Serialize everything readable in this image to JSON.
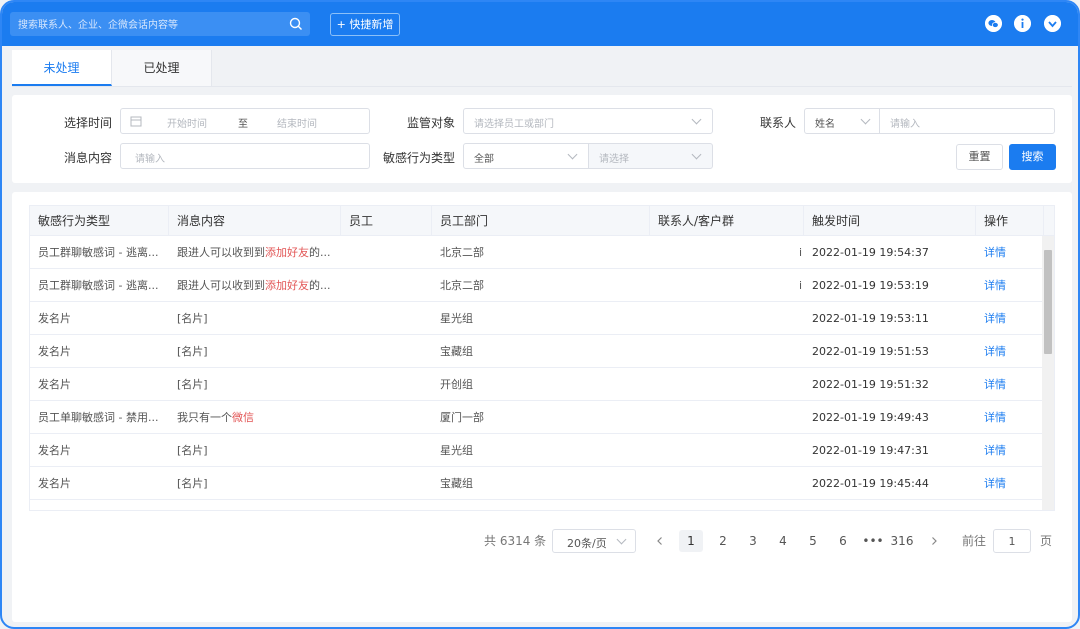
{
  "topbar": {
    "search_placeholder": "搜索联系人、企业、企微会话内容等",
    "quick_add": "+ 快捷新增",
    "icons": [
      "search-icon",
      "wechat-icon",
      "info-icon",
      "download-icon"
    ]
  },
  "tabs": [
    {
      "label": "未处理",
      "active": true
    },
    {
      "label": "已处理",
      "active": false
    }
  ],
  "filters": {
    "time_label": "选择时间",
    "start_placeholder": "开始时间",
    "to": "至",
    "end_placeholder": "结束时间",
    "target_label": "监管对象",
    "target_placeholder": "请选择员工或部门",
    "contact_label": "联系人",
    "contact_type": "姓名",
    "contact_placeholder": "请输入",
    "message_label": "消息内容",
    "message_placeholder": "请输入",
    "behavior_label": "敏感行为类型",
    "behavior_value": "全部",
    "behavior_sub_placeholder": "请选择",
    "reset": "重置",
    "search": "搜索"
  },
  "table": {
    "headers": [
      "敏感行为类型",
      "消息内容",
      "员工",
      "员工部门",
      "联系人/客户群",
      "触发时间",
      "操作"
    ],
    "rows": [
      {
        "type": "员工群聊敏感词 - 逃离...",
        "msg_pre": "跟进人可以收到到",
        "msg_hl": "添加好友",
        "msg_post": "的...",
        "employee": "",
        "dept": "北京二部",
        "contact": "i",
        "time": "2022-01-19 19:54:37",
        "action": "详情"
      },
      {
        "type": "员工群聊敏感词 - 逃离...",
        "msg_pre": "跟进人可以收到到",
        "msg_hl": "添加好友",
        "msg_post": "的...",
        "employee": "",
        "dept": "北京二部",
        "contact": "i",
        "time": "2022-01-19 19:53:19",
        "action": "详情"
      },
      {
        "type": "发名片",
        "msg_pre": "[名片]",
        "msg_hl": "",
        "msg_post": "",
        "employee": "",
        "dept": "星光组",
        "contact": "",
        "time": "2022-01-19 19:53:11",
        "action": "详情"
      },
      {
        "type": "发名片",
        "msg_pre": "[名片]",
        "msg_hl": "",
        "msg_post": "",
        "employee": "",
        "dept": "宝藏组",
        "contact": "",
        "time": "2022-01-19 19:51:53",
        "action": "详情"
      },
      {
        "type": "发名片",
        "msg_pre": "[名片]",
        "msg_hl": "",
        "msg_post": "",
        "employee": "",
        "dept": "开创组",
        "contact": "",
        "time": "2022-01-19 19:51:32",
        "action": "详情"
      },
      {
        "type": "员工单聊敏感词 - 禁用...",
        "msg_pre": "我只有一个",
        "msg_hl": "微信",
        "msg_post": "",
        "employee": "",
        "dept": "厦门一部",
        "contact": "",
        "time": "2022-01-19 19:49:43",
        "action": "详情"
      },
      {
        "type": "发名片",
        "msg_pre": "[名片]",
        "msg_hl": "",
        "msg_post": "",
        "employee": "",
        "dept": "星光组",
        "contact": "",
        "time": "2022-01-19 19:47:31",
        "action": "详情"
      },
      {
        "type": "发名片",
        "msg_pre": "[名片]",
        "msg_hl": "",
        "msg_post": "",
        "employee": "",
        "dept": "宝藏组",
        "contact": "",
        "time": "2022-01-19 19:45:44",
        "action": "详情"
      }
    ]
  },
  "pagination": {
    "total": "共 6314 条",
    "page_size": "20条/页",
    "pages": [
      "1",
      "2",
      "3",
      "4",
      "5",
      "6",
      "•••",
      "316"
    ],
    "current": "1",
    "goto_label": "前往",
    "goto_value": "1",
    "goto_suffix": "页"
  },
  "colors": {
    "primary": "#1b7cf0",
    "highlight": "#e25555"
  }
}
